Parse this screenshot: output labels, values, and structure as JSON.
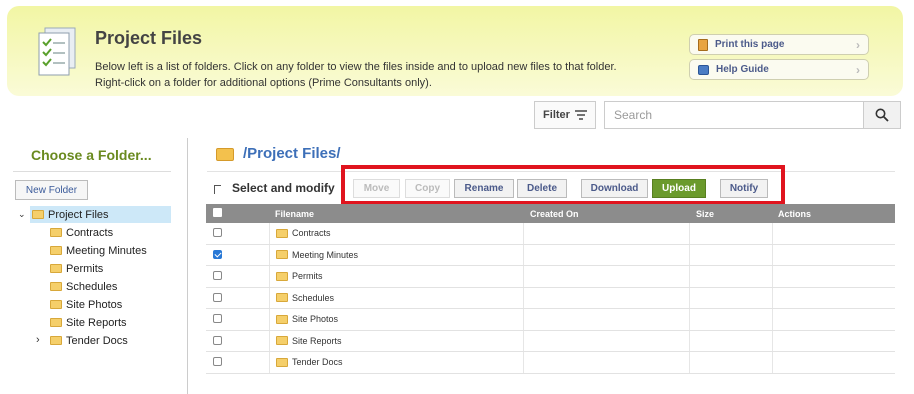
{
  "header": {
    "title": "Project Files",
    "description_line1": "Below left is a list of folders. Click on any folder to view the files inside and to upload new files to that folder.",
    "description_line2": "Right-click on a folder for additional options (Prime Consultants only).",
    "print_label": "Print this page",
    "help_label": "Help Guide"
  },
  "filter": {
    "label": "Filter",
    "search_placeholder": "Search"
  },
  "sidebar": {
    "heading": "Choose a Folder...",
    "new_folder_label": "New Folder",
    "root": "Project Files",
    "folders": [
      "Contracts",
      "Meeting Minutes",
      "Permits",
      "Schedules",
      "Site Photos",
      "Site Reports",
      "Tender Docs"
    ]
  },
  "main": {
    "path": "/Project Files/",
    "select_label": "Select and modify",
    "toolbar": {
      "move": "Move",
      "copy": "Copy",
      "rename": "Rename",
      "delete": "Delete",
      "download": "Download",
      "upload": "Upload",
      "notify": "Notify"
    },
    "columns": {
      "filename": "Filename",
      "created": "Created On",
      "size": "Size",
      "actions": "Actions"
    },
    "rows": [
      {
        "name": "Contracts",
        "checked": false
      },
      {
        "name": "Meeting Minutes",
        "checked": true
      },
      {
        "name": "Permits",
        "checked": false
      },
      {
        "name": "Schedules",
        "checked": false
      },
      {
        "name": "Site Photos",
        "checked": false
      },
      {
        "name": "Site Reports",
        "checked": false
      },
      {
        "name": "Tender Docs",
        "checked": false
      }
    ]
  },
  "colors": {
    "accent_green": "#6b9a2c",
    "link_blue": "#3d6fb8",
    "highlight_red": "#e0141e"
  }
}
